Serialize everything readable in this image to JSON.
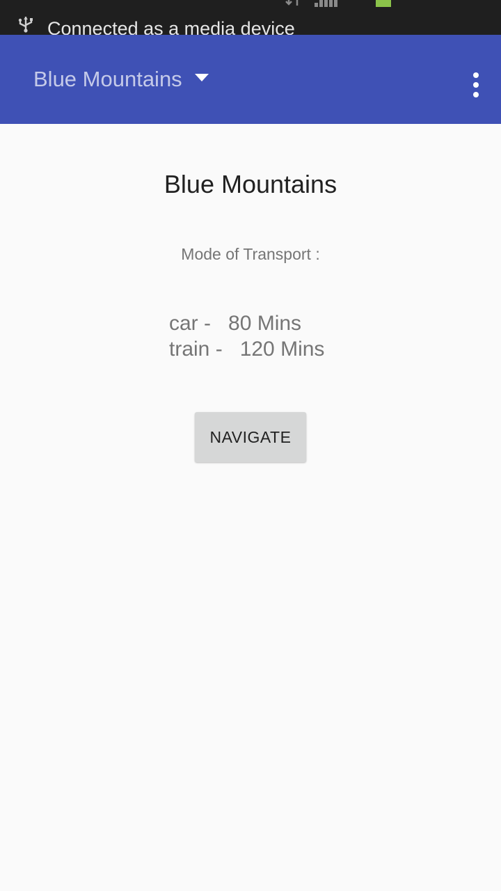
{
  "status_bar": {
    "notification": "Connected as a media device",
    "battery_color": "#8bc34a",
    "icons": [
      "usb-icon",
      "data-arrows-icon",
      "signal-icon",
      "battery-icon"
    ]
  },
  "toolbar": {
    "selected_location": "Blue Mountains",
    "background_color": "#3f51b5",
    "dropdown_icon": "caret-down-icon",
    "menu_icon": "overflow-menu-icon"
  },
  "main": {
    "title": "Blue Mountains",
    "mode_label": "Mode of Transport :",
    "transport": [
      "car -   80 Mins",
      "train -   120 Mins"
    ],
    "navigate_label": "NAVIGATE"
  }
}
